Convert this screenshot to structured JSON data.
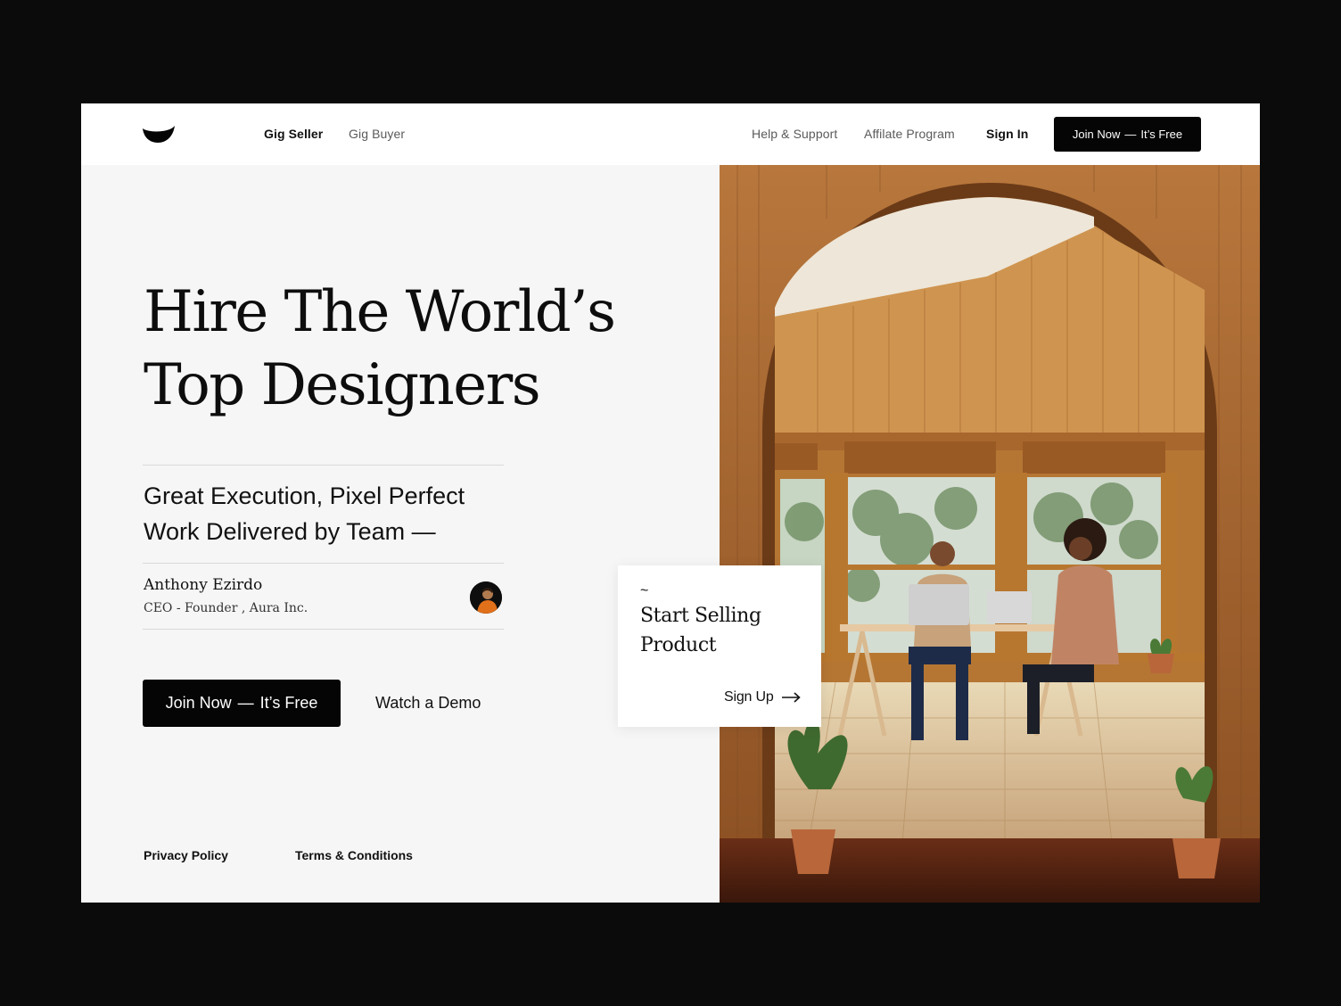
{
  "header": {
    "logo": "smile-logo",
    "nav_left": [
      {
        "label": "Gig Seller",
        "active": true
      },
      {
        "label": "Gig Buyer",
        "active": false
      }
    ],
    "help_label": "Help & Support",
    "affiliate_label": "Affilate Program",
    "signin_label": "Sign In",
    "join_button": {
      "main": "Join Now",
      "dash": "—",
      "suffix": "It’s Free"
    }
  },
  "hero": {
    "headline_line1": "Hire The World’s",
    "headline_line2": "Top Designers",
    "subhead_line1": "Great Execution, Pixel Perfect",
    "subhead_line2": "Work Delivered by Team —",
    "author": {
      "name": "Anthony Ezirdo",
      "role": "CEO - Founder , Aura Inc."
    },
    "cta_button": {
      "main": "Join Now",
      "dash": "—",
      "suffix": "It’s Free"
    },
    "demo_link": "Watch a Demo"
  },
  "card": {
    "tilde": "~",
    "title": "Start Selling Product",
    "signup_label": "Sign Up",
    "arrow_icon": "arrow-right-icon"
  },
  "footer": {
    "privacy": "Privacy Policy",
    "terms": "Terms & Conditions"
  },
  "colors": {
    "page_bg": "#0b0b0b",
    "panel_bg": "#f6f6f6",
    "button_bg": "#050505",
    "text": "#111111"
  }
}
